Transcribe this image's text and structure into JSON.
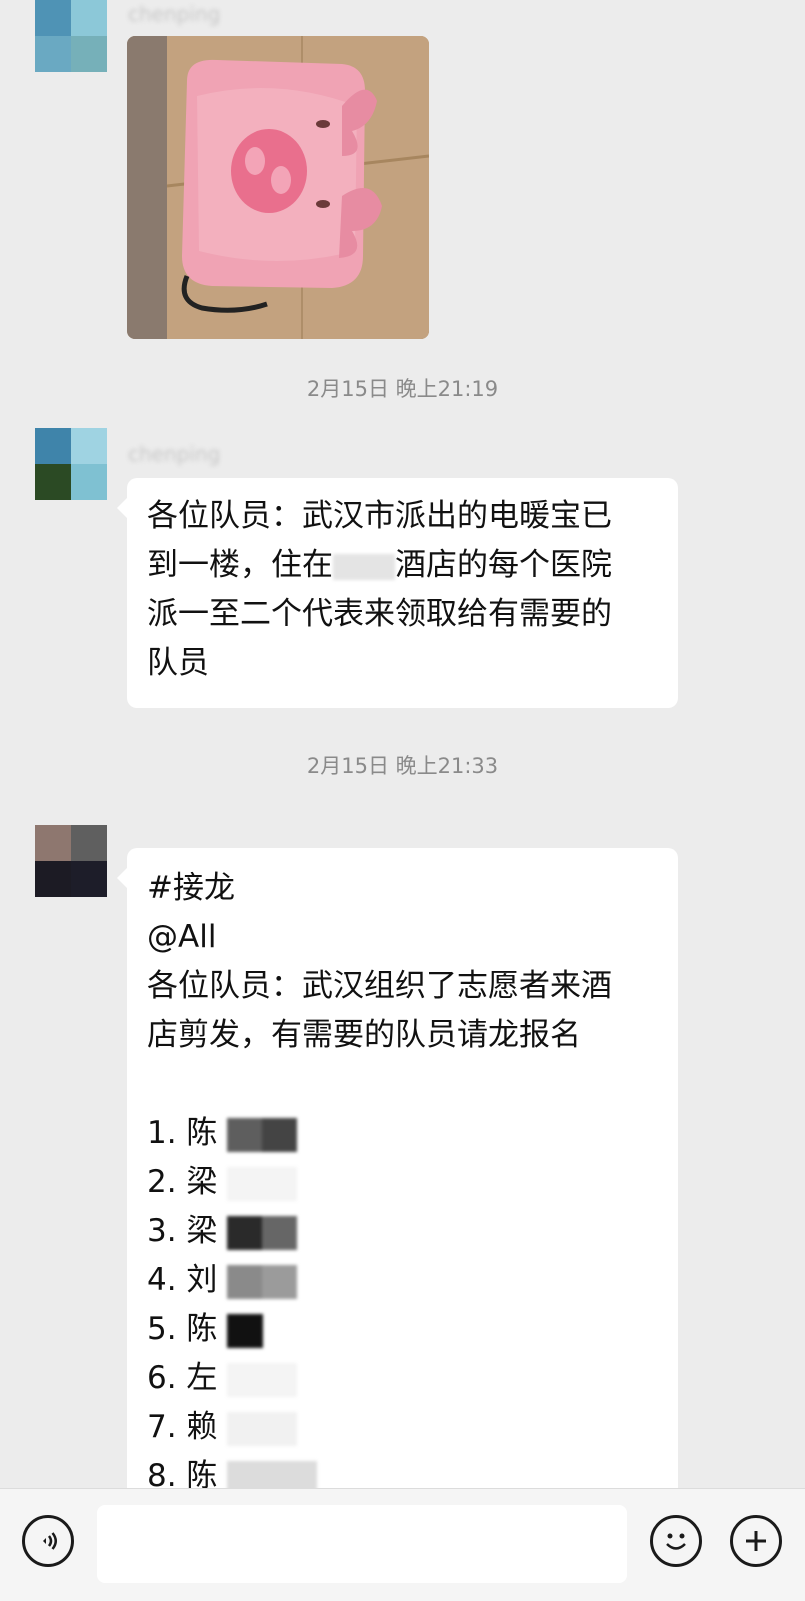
{
  "messages": [
    {
      "type": "image",
      "sender": "chenping",
      "image_alt": "pink pig hand warmer"
    },
    {
      "type": "time",
      "text": "2月15日 晚上21:19"
    },
    {
      "type": "text",
      "sender": "chenping",
      "lines": [
        "各位队员：武汉市派出的电暖宝已",
        "到一楼，住在",
        "酒店的每个医院",
        "派一至二个代表来领取给有需要的",
        "队员"
      ]
    },
    {
      "type": "time",
      "text": "2月15日 晚上21:33"
    },
    {
      "type": "text",
      "lines": [
        "#接龙",
        "@All",
        "各位队员：武汉组织了志愿者来酒",
        "店剪发，有需要的队员请龙报名"
      ],
      "list": [
        "1. 陈",
        "2. 梁",
        "3. 梁",
        "4. 刘",
        "5. 陈",
        "6. 左",
        "7. 赖",
        "8. 陈"
      ]
    }
  ],
  "bottom_bar": {
    "voice_icon": "voice-icon",
    "emoji_icon": "emoji-icon",
    "plus_icon": "plus-icon",
    "input_value": ""
  }
}
